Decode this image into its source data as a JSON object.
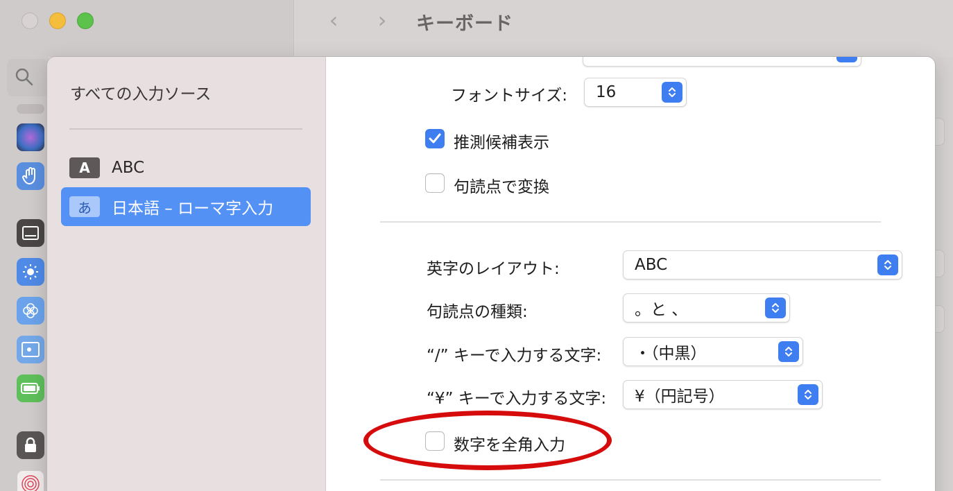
{
  "window": {
    "title": "キーボード",
    "nav": {
      "back": "‹",
      "forward": "›"
    }
  },
  "sources": {
    "title": "すべての入力ソース",
    "items": [
      {
        "badge": "A",
        "label": "ABC"
      },
      {
        "badge": "あ",
        "label": "日本語 – ローマ字入力",
        "selected": true
      }
    ]
  },
  "settings": {
    "font_size": {
      "label": "フォントサイズ:",
      "value": "16"
    },
    "predictive": {
      "label": "推測候補表示",
      "checked": true
    },
    "punct_convert": {
      "label": "句読点で変換",
      "checked": false
    },
    "alpha_layout": {
      "label": "英字のレイアウト:",
      "value": "ABC"
    },
    "punct_type": {
      "label": "句読点の種類:",
      "value": "。と 、"
    },
    "slash_key": {
      "label": "“/” キーで入力する文字:",
      "value": "・（中黒）"
    },
    "yen_key": {
      "label": "“¥” キーで入力する文字:",
      "value": "¥（円記号）"
    },
    "fullwidth_numbers": {
      "label": "数字を全角入力",
      "checked": false
    }
  },
  "colors": {
    "accent": "#3f7ef0",
    "selection": "#5491f5",
    "highlight_ring": "#d60b0b"
  }
}
